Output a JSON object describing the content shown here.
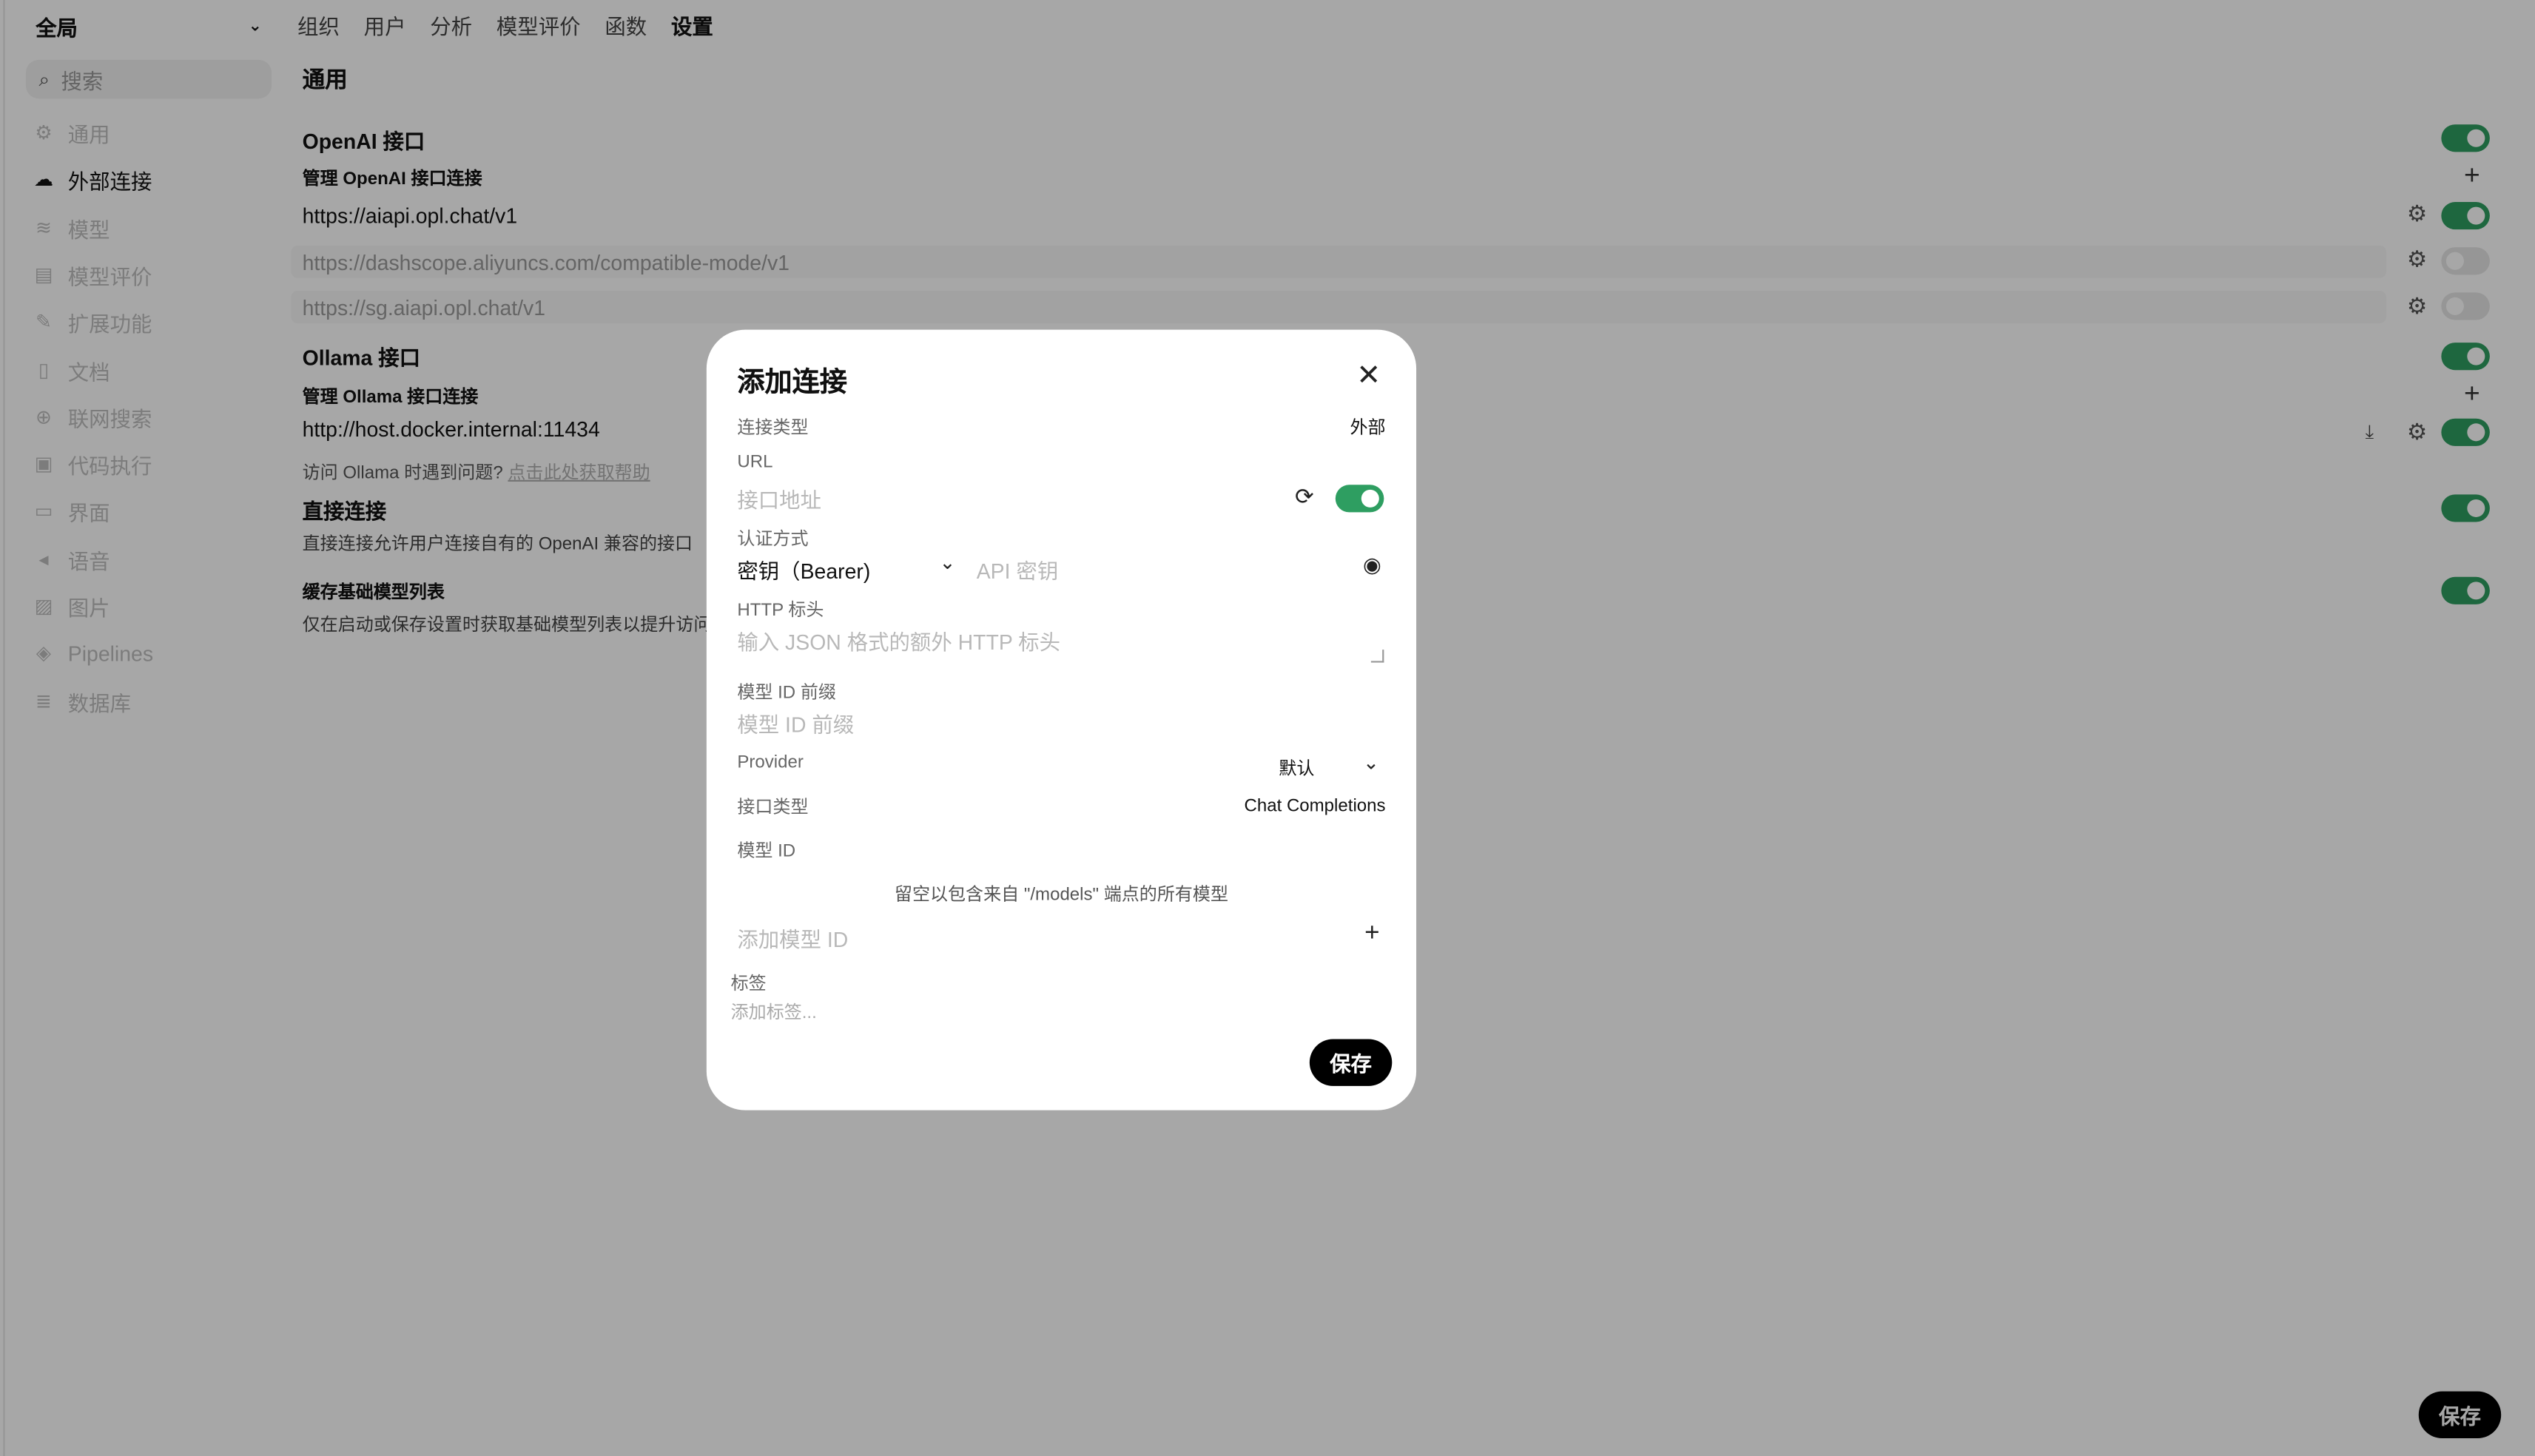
{
  "sidebar": {
    "scope": "全局",
    "search_placeholder": "搜索",
    "items": [
      {
        "label": "通用",
        "icon": "gear-icon"
      },
      {
        "label": "外部连接",
        "icon": "cloud-icon"
      },
      {
        "label": "模型",
        "icon": "stack-icon"
      },
      {
        "label": "模型评价",
        "icon": "document-icon"
      },
      {
        "label": "扩展功能",
        "icon": "wrench-icon"
      },
      {
        "label": "文档",
        "icon": "file-icon"
      },
      {
        "label": "联网搜索",
        "icon": "globe-icon"
      },
      {
        "label": "代码执行",
        "icon": "code-icon"
      },
      {
        "label": "界面",
        "icon": "monitor-icon"
      },
      {
        "label": "语音",
        "icon": "speaker-icon"
      },
      {
        "label": "图片",
        "icon": "image-icon"
      },
      {
        "label": "Pipelines",
        "icon": "pipeline-icon"
      },
      {
        "label": "数据库",
        "icon": "database-icon"
      }
    ]
  },
  "tabs": [
    "组织",
    "用户",
    "分析",
    "模型评价",
    "函数",
    "设置"
  ],
  "main": {
    "section_title": "通用",
    "openai_title": "OpenAI 接口",
    "openai_manage": "管理 OpenAI 接口连接",
    "openai_urls": [
      "https://aiapi.opl.chat/v1",
      "https://dashscope.aliyuncs.com/compatible-mode/v1",
      "https://sg.aiapi.opl.chat/v1"
    ],
    "ollama_title": "Ollama 接口",
    "ollama_manage": "管理 Ollama 接口连接",
    "ollama_url": "http://host.docker.internal:11434",
    "ollama_help_q": "访问 Ollama 时遇到问题?",
    "ollama_help_link": "点击此处获取帮助",
    "direct_title": "直接连接",
    "direct_desc": "直接连接允许用户连接自有的 OpenAI 兼容的接口",
    "cache_title": "缓存基础模型列表",
    "cache_desc": "仅在启动或保存设置时获取基础模型列表以提升访问",
    "save_label": "保存"
  },
  "modal": {
    "title": "添加连接",
    "conn_type_label": "连接类型",
    "conn_type_value": "外部",
    "url_label": "URL",
    "url_placeholder": "接口地址",
    "auth_label": "认证方式",
    "auth_value": "密钥（Bearer)",
    "api_key_placeholder": "API 密钥",
    "http_header_label": "HTTP 标头",
    "http_header_placeholder": "输入 JSON 格式的额外 HTTP 标头",
    "prefix_label": "模型 ID 前缀",
    "prefix_placeholder": "模型 ID 前缀",
    "provider_label": "Provider",
    "provider_value": "默认",
    "api_type_label": "接口类型",
    "api_type_value": "Chat Completions",
    "model_id_label": "模型 ID",
    "model_id_hint": "留空以包含来自 \"/models\" 端点的所有模型",
    "add_model_placeholder": "添加模型 ID",
    "tags_label": "标签",
    "tags_placeholder": "添加标签...",
    "save_label": "保存"
  }
}
